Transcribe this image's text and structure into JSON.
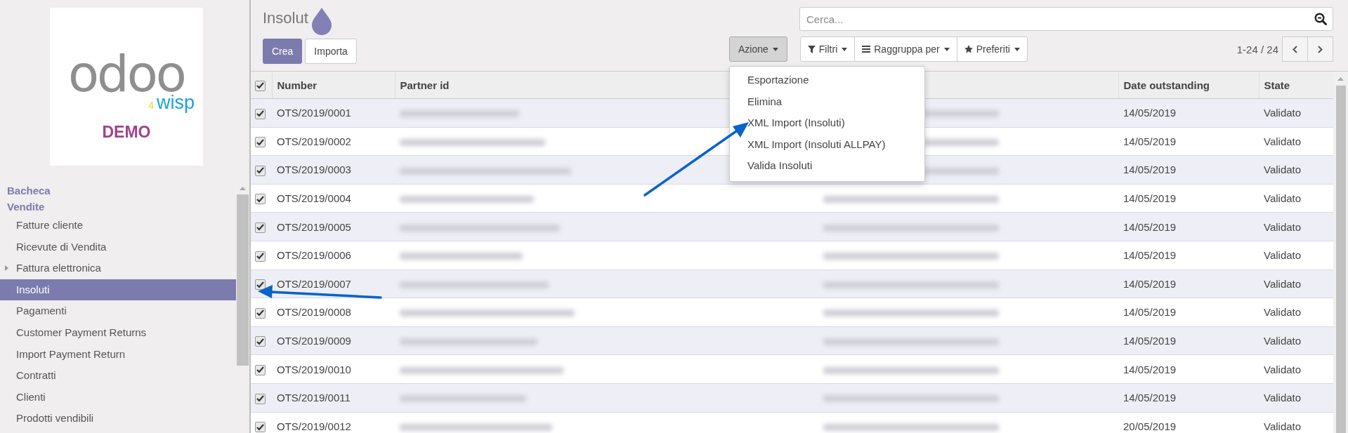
{
  "sidebar": {
    "logo": {
      "wordmark": "odoo",
      "number": "4",
      "tag": "wisp",
      "caption": "DEMO"
    },
    "menu": [
      {
        "label": "Bacheca",
        "kind": "section"
      },
      {
        "label": "Vendite",
        "kind": "section"
      },
      {
        "label": "Fatture cliente",
        "kind": "item",
        "selected": false
      },
      {
        "label": "Ricevute di Vendita",
        "kind": "item",
        "selected": false
      },
      {
        "label": "Fattura elettronica",
        "kind": "folder",
        "expanded": false,
        "selected": false
      },
      {
        "label": "Insoluti",
        "kind": "item",
        "selected": true
      },
      {
        "label": "Pagamenti",
        "kind": "item",
        "selected": false
      },
      {
        "label": "Customer Payment Returns",
        "kind": "item",
        "selected": false
      },
      {
        "label": "Import Payment Return",
        "kind": "item",
        "selected": false
      },
      {
        "label": "Contratti",
        "kind": "item",
        "selected": false
      },
      {
        "label": "Clienti",
        "kind": "item",
        "selected": false
      },
      {
        "label": "Prodotti vendibili",
        "kind": "item",
        "selected": false
      }
    ]
  },
  "control_panel": {
    "title": "Insolut",
    "buttons": [
      {
        "label": "Crea",
        "kind": "primary"
      },
      {
        "label": "Importa",
        "kind": "default"
      }
    ],
    "action": {
      "label": "Azione",
      "expanded": true,
      "menu": [
        "Esportazione",
        "Elimina",
        "XML Import (Insoluti)",
        "XML Import (Insoluti ALLPAY)",
        "Valida Insoluti"
      ]
    },
    "search": {
      "placeholder": "Cerca..."
    },
    "search_options": [
      {
        "label": "Filtri",
        "kind": "filter"
      },
      {
        "label": "Raggruppa per",
        "kind": "group"
      },
      {
        "label": "Preferiti",
        "kind": "favorite"
      }
    ],
    "pager": "1-24 / 24"
  },
  "table": {
    "select_all": {
      "checked": true
    },
    "columns": [
      {
        "label": "Number",
        "kind": "text"
      },
      {
        "label": "Partner id",
        "kind": "blurred"
      },
      {
        "kind": "blurred"
      },
      {
        "label": "Date outstanding",
        "kind": "text"
      },
      {
        "label": "State",
        "kind": "text"
      }
    ],
    "rows": [
      {
        "checked": true,
        "cells": [
          "OTS/2019/0001",
          "14/05/2019",
          "Validato"
        ]
      },
      {
        "checked": true,
        "cells": [
          "OTS/2019/0002",
          "14/05/2019",
          "Validato"
        ]
      },
      {
        "checked": true,
        "cells": [
          "OTS/2019/0003",
          "14/05/2019",
          "Validato"
        ]
      },
      {
        "checked": true,
        "cells": [
          "OTS/2019/0004",
          "14/05/2019",
          "Validato"
        ]
      },
      {
        "checked": true,
        "cells": [
          "OTS/2019/0005",
          "14/05/2019",
          "Validato"
        ]
      },
      {
        "checked": true,
        "cells": [
          "OTS/2019/0006",
          "14/05/2019",
          "Validato"
        ]
      },
      {
        "checked": true,
        "cells": [
          "OTS/2019/0007",
          "14/05/2019",
          "Validato"
        ]
      },
      {
        "checked": true,
        "cells": [
          "OTS/2019/0008",
          "14/05/2019",
          "Validato"
        ]
      },
      {
        "checked": true,
        "cells": [
          "OTS/2019/0009",
          "14/05/2019",
          "Validato"
        ]
      },
      {
        "checked": true,
        "cells": [
          "OTS/2019/0010",
          "14/05/2019",
          "Validato"
        ]
      },
      {
        "checked": true,
        "cells": [
          "OTS/2019/0011",
          "14/05/2019",
          "Validato"
        ]
      },
      {
        "checked": true,
        "cells": [
          "OTS/2019/0012",
          "20/05/2019",
          "Validato"
        ]
      }
    ]
  }
}
